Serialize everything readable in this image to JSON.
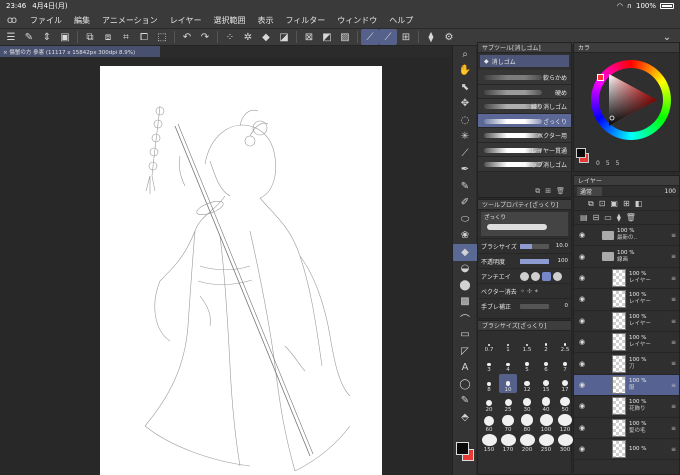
{
  "status": {
    "time": "23:46",
    "date": "4月4日(月)",
    "battery": "100%"
  },
  "menu": {
    "items": [
      "ファイル",
      "編集",
      "アニメーション",
      "レイヤー",
      "選択範囲",
      "表示",
      "フィルター",
      "ウィンドウ",
      "ヘルプ"
    ]
  },
  "document": {
    "tab_title": "× 傷蟹の方 參憲 (11117 x 15842px 300dpi 8.9%)"
  },
  "panels": {
    "subtool_title": "サブツール[消しゴム]",
    "subtool_tab": "消しゴム",
    "brushes": [
      {
        "label": "軟らかめ",
        "selected": false
      },
      {
        "label": "硬め",
        "selected": false
      },
      {
        "label": "練り消しゴム",
        "selected": false
      },
      {
        "label": "ざっくり",
        "selected": true
      },
      {
        "label": "ベクター用",
        "selected": false
      },
      {
        "label": "レイヤー貫通",
        "selected": false
      },
      {
        "label": "スナップ消しゴム",
        "selected": false
      }
    ],
    "toolprop_title": "ツールプロパティ[ざっくり]",
    "toolprop_preview": "ざっくり",
    "brush_size_label": "ブラシサイズ",
    "brush_size_value": "10.0",
    "opacity_label": "不透明度",
    "opacity_value": "100",
    "antialias_label": "アンチエイ",
    "vector_label": "ベクター消去",
    "hand_label": "手ブレ補正",
    "hand_value": "0",
    "brushsize_title": "ブラシサイズ[ざっくり]",
    "sizes": [
      "0.7",
      "1",
      "1.5",
      "2",
      "2.5",
      "3",
      "4",
      "5",
      "6",
      "7",
      "8",
      "10",
      "12",
      "15",
      "17",
      "20",
      "25",
      "30",
      "40",
      "50",
      "60",
      "70",
      "80",
      "100",
      "120",
      "150",
      "170",
      "200",
      "250",
      "300"
    ],
    "selected_size": "10",
    "color_title": "カラ",
    "color_values": [
      "0",
      "5",
      "5"
    ],
    "layer_title": "レイヤー",
    "blend_mode": "通常",
    "layer_opacity": "100",
    "layers": [
      {
        "pct": "100 %",
        "name": "最新の..",
        "type": "folder",
        "selected": false
      },
      {
        "pct": "100 %",
        "name": "線画",
        "type": "folder",
        "selected": false
      },
      {
        "pct": "100 %",
        "name": "レイヤー",
        "type": "layer",
        "selected": false
      },
      {
        "pct": "100 %",
        "name": "レイヤー",
        "type": "layer",
        "selected": false
      },
      {
        "pct": "100 %",
        "name": "レイヤー",
        "type": "layer",
        "selected": false
      },
      {
        "pct": "100 %",
        "name": "レイヤー",
        "type": "layer",
        "selected": false
      },
      {
        "pct": "100 %",
        "name": "刀",
        "type": "layer",
        "selected": false
      },
      {
        "pct": "100 %",
        "name": "服",
        "type": "layer",
        "selected": true
      },
      {
        "pct": "100 %",
        "name": "花飾り",
        "type": "layer",
        "selected": false
      },
      {
        "pct": "100 %",
        "name": "髪の毛",
        "type": "layer",
        "selected": false
      },
      {
        "pct": "100 %",
        "name": "",
        "type": "layer",
        "selected": false
      }
    ]
  },
  "colors": {
    "main": "#0a0a0a",
    "sub": "#e53a36",
    "accent": "#5a6894"
  }
}
